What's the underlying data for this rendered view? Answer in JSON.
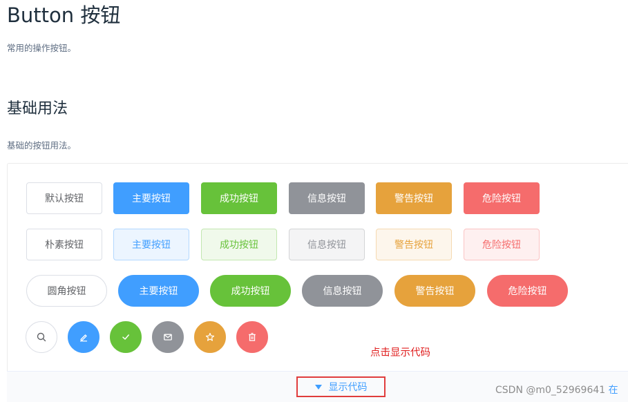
{
  "page": {
    "title": "Button 按钮",
    "subtitle": "常用的操作按钮。"
  },
  "section": {
    "heading": "基础用法",
    "description": "基础的按钮用法。"
  },
  "rows": {
    "default": [
      "默认按钮",
      "主要按钮",
      "成功按钮",
      "信息按钮",
      "警告按钮",
      "危险按钮"
    ],
    "plain": [
      "朴素按钮",
      "主要按钮",
      "成功按钮",
      "信息按钮",
      "警告按钮",
      "危险按钮"
    ],
    "round": [
      "圆角按钮",
      "主要按钮",
      "成功按钮",
      "信息按钮",
      "警告按钮",
      "危险按钮"
    ],
    "circle_icons": [
      "search-icon",
      "edit-icon",
      "check-icon",
      "message-icon",
      "star-icon",
      "delete-icon"
    ]
  },
  "colors": {
    "primary": "#409eff",
    "success": "#67c23a",
    "info": "#909399",
    "warning": "#e6a23c",
    "danger": "#f56c6c",
    "annotation": "#e02020"
  },
  "annotation": "点击显示代码",
  "code_toggle": {
    "label": "显示代码"
  },
  "watermark": {
    "text": "CSDN @m0_52969641",
    "trailing": "在"
  }
}
